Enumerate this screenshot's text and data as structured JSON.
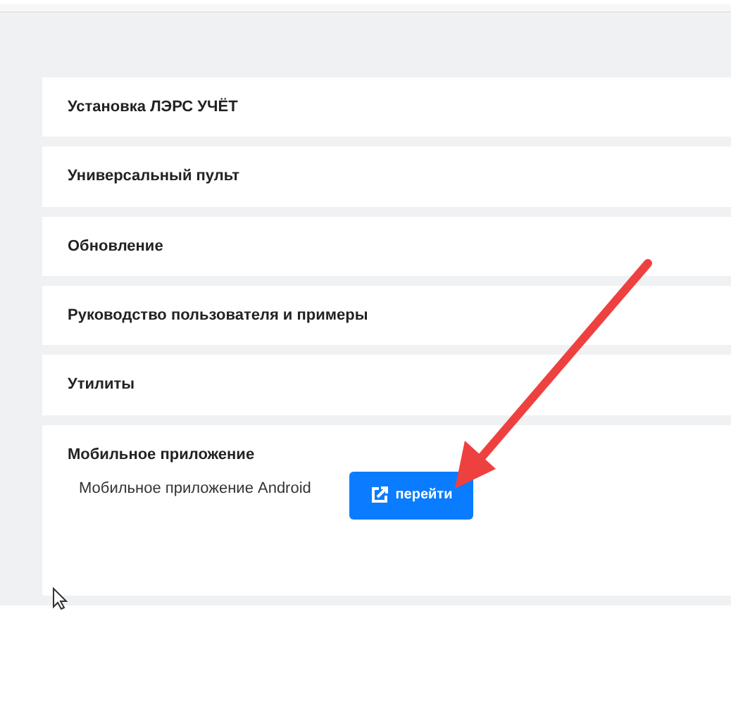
{
  "sections": [
    {
      "title": "Установка ЛЭРС УЧЁТ",
      "expanded": false
    },
    {
      "title": "Универсальный пульт",
      "expanded": false
    },
    {
      "title": "Обновление",
      "expanded": false
    },
    {
      "title": "Руководство пользователя и примеры",
      "expanded": false
    },
    {
      "title": "Утилиты",
      "expanded": false
    },
    {
      "title": "Мобильное приложение",
      "expanded": true,
      "items": [
        {
          "label": "Мобильное приложение Android",
          "button": "перейти"
        }
      ]
    }
  ]
}
